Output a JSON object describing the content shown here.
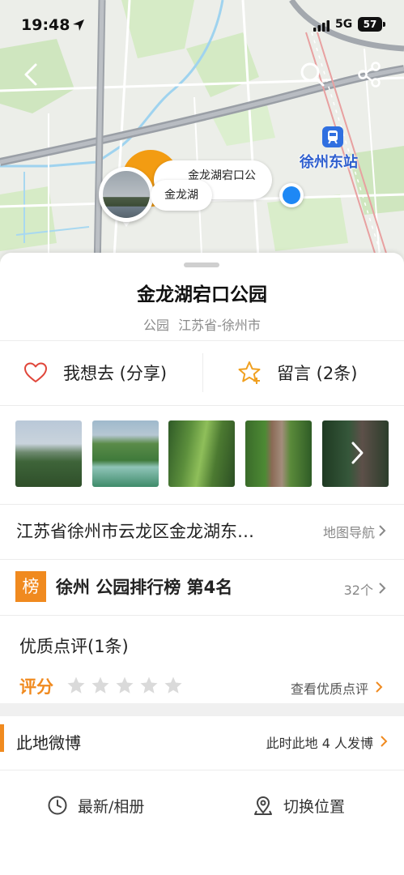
{
  "status_bar": {
    "time": "19:48",
    "network": "5G",
    "battery": "57"
  },
  "map": {
    "station_label": "徐州东站",
    "poi_bubble_label": "金龙湖宕口公",
    "pin_label": "金龙湖"
  },
  "poi": {
    "title": "金龙湖宕口公园",
    "category": "公园",
    "region": "江苏省-徐州市"
  },
  "actions": {
    "want_label": "我想去 (分享)",
    "comment_label": "留言 (2条)"
  },
  "address": {
    "text": "江苏省徐州市云龙区金龙湖东…",
    "nav_label": "地图导航"
  },
  "ranking": {
    "badge": "榜",
    "text": "徐州 公园排行榜 第4名",
    "count": "32个"
  },
  "reviews": {
    "title": "优质点评(1条)",
    "rating_label": "评分",
    "rating_value": 0,
    "rating_max": 5,
    "view_label": "查看优质点评"
  },
  "weibo": {
    "title": "此地微博",
    "count_label": "此时此地 4 人发博"
  },
  "bottom_tabs": {
    "latest": "最新/相册",
    "switch": "切换位置"
  },
  "colors": {
    "accent": "#f08a1f",
    "user_dot": "#1e88f5",
    "station": "#2f5fcf"
  }
}
